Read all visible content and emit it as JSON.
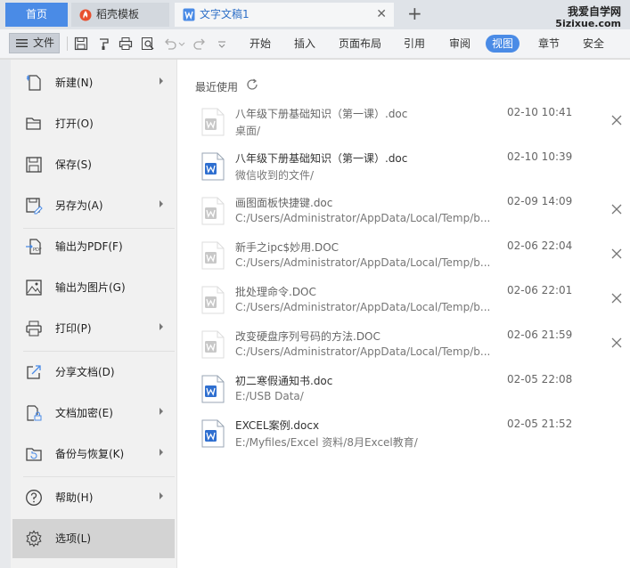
{
  "tabs": {
    "home": "首页",
    "template": "稻壳模板",
    "document": "文字文稿1",
    "add": "+"
  },
  "brand": {
    "name": "我爱自学网",
    "domain": "5izixue.com"
  },
  "toolbar": {
    "file_label": "文件",
    "menu_tabs": [
      "开始",
      "插入",
      "页面布局",
      "引用",
      "审阅",
      "视图",
      "章节",
      "安全"
    ],
    "active_tab": "视图"
  },
  "file_menu": {
    "items": [
      {
        "label": "新建(N)",
        "icon": "new-icon",
        "submenu": true
      },
      {
        "label": "打开(O)",
        "icon": "open-folder-icon",
        "submenu": false
      },
      {
        "label": "保存(S)",
        "icon": "save-icon",
        "submenu": false
      },
      {
        "label": "另存为(A)",
        "icon": "save-as-icon",
        "submenu": true
      },
      {
        "label": "输出为PDF(F)",
        "icon": "export-pdf-icon",
        "submenu": false
      },
      {
        "label": "输出为图片(G)",
        "icon": "export-image-icon",
        "submenu": false
      },
      {
        "label": "打印(P)",
        "icon": "print-icon",
        "submenu": true
      },
      {
        "label": "分享文档(D)",
        "icon": "share-icon",
        "submenu": false
      },
      {
        "label": "文档加密(E)",
        "icon": "encrypt-icon",
        "submenu": true
      },
      {
        "label": "备份与恢复(K)",
        "icon": "backup-icon",
        "submenu": true
      },
      {
        "label": "帮助(H)",
        "icon": "help-icon",
        "submenu": true
      },
      {
        "label": "选项(L)",
        "icon": "gear-icon",
        "submenu": false
      }
    ],
    "selected": "选项(L)"
  },
  "recent": {
    "title": "最近使用",
    "files": [
      {
        "name": "八年级下册基础知识（第一课）.doc",
        "path": "桌面/",
        "date": "02-10 10:41",
        "available": false,
        "closable": true
      },
      {
        "name": "八年级下册基础知识（第一课）.doc",
        "path": "微信收到的文件/",
        "date": "02-10 10:39",
        "available": true,
        "closable": false
      },
      {
        "name": "画图面板快捷键.doc",
        "path": "C:/Users/Administrator/AppData/Local/Temp/b...",
        "date": "02-09 14:09",
        "available": false,
        "closable": true
      },
      {
        "name": "新手之ipc$妙用.DOC",
        "path": "C:/Users/Administrator/AppData/Local/Temp/b...",
        "date": "02-06 22:04",
        "available": false,
        "closable": true
      },
      {
        "name": "批处理命令.DOC",
        "path": "C:/Users/Administrator/AppData/Local/Temp/b...",
        "date": "02-06 22:01",
        "available": false,
        "closable": true
      },
      {
        "name": "改变硬盘序列号码的方法.DOC",
        "path": "C:/Users/Administrator/AppData/Local/Temp/b...",
        "date": "02-06 21:59",
        "available": false,
        "closable": true
      },
      {
        "name": "初二寒假通知书.doc",
        "path": "E:/USB Data/",
        "date": "02-05 22:08",
        "available": true,
        "closable": false
      },
      {
        "name": "EXCEL案例.docx",
        "path": "E:/Myfiles/Excel 资料/8月Excel教育/",
        "date": "02-05 21:52",
        "available": true,
        "closable": false
      }
    ]
  },
  "colors": {
    "accent": "#4a8be6",
    "tab_bar": "#dfe3e8",
    "menu_bg": "#f1f1f1",
    "selected_item": "#d3d3d3",
    "word_blue": "#2f6fd0",
    "unavailable_gray": "#c8c8c8"
  }
}
